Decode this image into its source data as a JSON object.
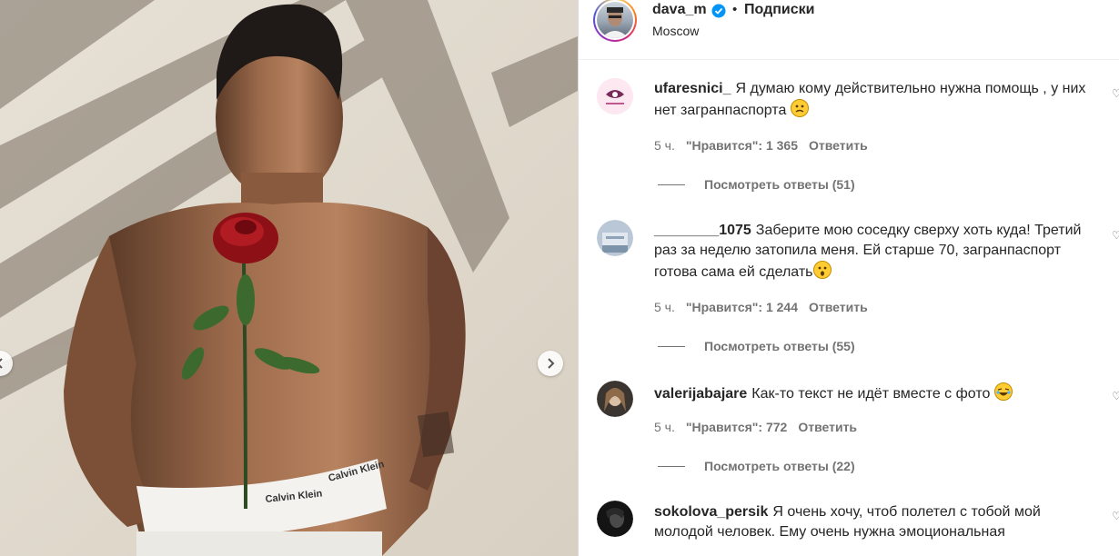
{
  "post": {
    "username": "dava_m",
    "dot": "•",
    "follow_label": "Подписки",
    "location": "Moscow",
    "media_texts": [
      "Calvin Klein",
      "Calvin Klein"
    ]
  },
  "comments": [
    {
      "username": "ufaresnici_",
      "text": "Я думаю кому действительно нужна помощь , у них нет загранпаспорта",
      "emoji": "confused",
      "time": "5 ч.",
      "likes": "\"Нравится\": 1 365",
      "reply": "Ответить",
      "view_replies": "Посмотреть ответы (51)"
    },
    {
      "username": "________1075",
      "text": "Заберите мою соседку сверху хоть куда! Третий раз за неделю затопила меня. Ей старше 70, загранпаспорт готова сама ей сделать",
      "emoji": "astonished",
      "time": "5 ч.",
      "likes": "\"Нравится\": 1 244",
      "reply": "Ответить",
      "view_replies": "Посмотреть ответы (55)"
    },
    {
      "username": "valerijabajare",
      "text": "Как-то текст не идёт вместе с фото",
      "emoji": "laughing",
      "time": "5 ч.",
      "likes": "\"Нравится\": 772",
      "reply": "Ответить",
      "view_replies": "Посмотреть ответы (22)"
    },
    {
      "username": "sokolova_persik",
      "text": "Я очень хочу, чтоб полетел с тобой мой молодой человек. Ему очень нужна эмоциональная"
    }
  ],
  "icons": {
    "next": "chevron-right-icon",
    "prev": "chevron-left-icon",
    "verified": "verified-badge-icon",
    "like": "heart-icon"
  },
  "colors": {
    "verified": "#0095f6",
    "muted": "#737373",
    "text": "#262626"
  }
}
